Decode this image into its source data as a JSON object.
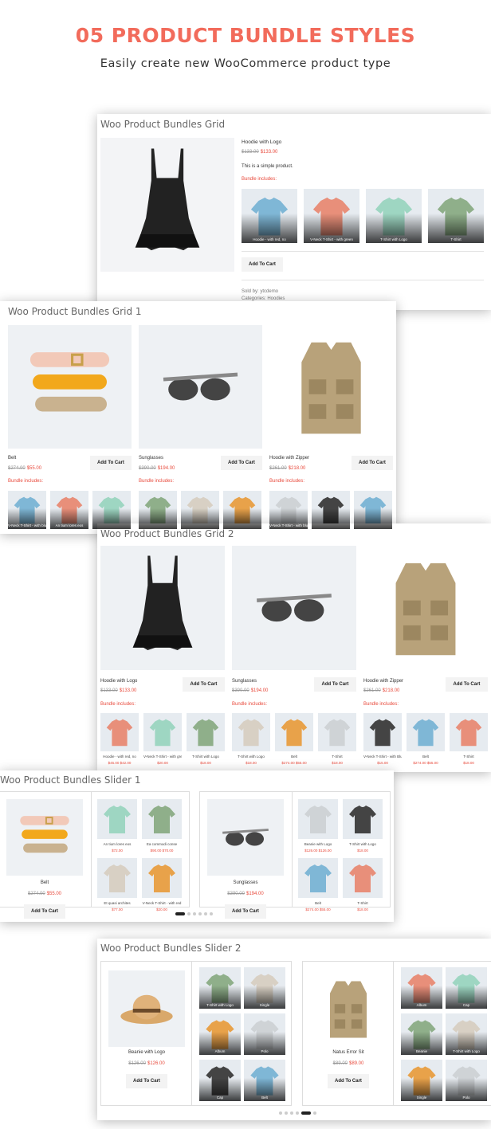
{
  "header": {
    "title": "05 PRODUCT BUNDLE STYLES",
    "subtitle": "Easily create new WooCommerce product type"
  },
  "grid": {
    "title": "Woo Product Bundles Grid",
    "product": "Hoodie with Logo",
    "old_price": "$133.00",
    "price": "$133.00",
    "desc": "This is a simple product.",
    "bundle_label": "Bundle includes:",
    "thumbs": [
      "Hoodie - with red, no",
      "V-Neck T-Shirt - with green",
      "T-Shirt with Logo",
      "T-Shirt"
    ],
    "add_to_cart": "Add To Cart",
    "sold_by": "Sold by: ytcdemo",
    "categories": "Categories: Hoodies"
  },
  "grid1": {
    "title": "Woo Product Bundles Grid 1",
    "bundle_label": "Bundle includes:",
    "add_to_cart": "Add To Cart",
    "products": [
      {
        "name": "Belt",
        "old": "$274.00",
        "price": "$55.00",
        "thumbs": [
          "V-Neck T-Shirt - with blue",
          "An tium lores eos",
          ""
        ]
      },
      {
        "name": "Sunglasses",
        "old": "$390.00",
        "price": "$194.00",
        "thumbs": [
          "",
          "",
          ""
        ]
      },
      {
        "name": "Hoodie with Zipper",
        "old": "$261.00",
        "price": "$218.00",
        "thumbs": [
          "V-Neck T-Shirt - with blue",
          "",
          ""
        ]
      }
    ]
  },
  "grid2": {
    "title": "Woo Product Bundles Grid 2",
    "bundle_label": "Bundle includes:",
    "add_to_cart": "Add To Cart",
    "products": [
      {
        "name": "Hoodie with Logo",
        "old": "$133.00",
        "price": "$133.00",
        "thumbs": [
          {
            "n": "Hoodie - with red, no",
            "p": "$45.00 $42.00"
          },
          {
            "n": "V-Neck T-Shirt - with green",
            "p": "$20.00"
          },
          {
            "n": "T-Shirt with Logo",
            "p": "$18.00"
          }
        ]
      },
      {
        "name": "Sunglasses",
        "old": "$390.00",
        "price": "$194.00",
        "thumbs": [
          {
            "n": "T-Shirt with Logo",
            "p": "$18.00"
          },
          {
            "n": "Belt",
            "p": "$274.00 $55.00"
          },
          {
            "n": "T-Shirt",
            "p": "$18.00"
          }
        ]
      },
      {
        "name": "Hoodie with Zipper",
        "old": "$261.00",
        "price": "$218.00",
        "thumbs": [
          {
            "n": "V-Neck T-Shirt - with Blue",
            "p": "$15.00"
          },
          {
            "n": "Belt",
            "p": "$274.00 $55.00"
          },
          {
            "n": "T-Shirt",
            "p": "$18.00"
          }
        ]
      }
    ]
  },
  "slider1": {
    "title": "Woo Product Bundles Slider 1",
    "add_to_cart": "Add To Cart",
    "cards": [
      {
        "name": "Belt",
        "old": "$274.00",
        "price": "$55.00",
        "items": [
          {
            "n": "An tium lores eos",
            "p": "$72.00"
          },
          {
            "n": "Ea commodi conse",
            "p": "$90.00 $70.00"
          },
          {
            "n": "Et quasi archites",
            "p": "$77.00"
          },
          {
            "n": "V-Neck T-Shirt - with red",
            "p": "$20.00"
          }
        ]
      },
      {
        "name": "Sunglasses",
        "old": "$390.00",
        "price": "$194.00",
        "items": [
          {
            "n": "Beanie with Logo",
            "p": "$126.00 $126.00"
          },
          {
            "n": "T-Shirt with Logo",
            "p": "$18.00"
          },
          {
            "n": "Belt",
            "p": "$274.00 $55.00"
          },
          {
            "n": "T-Shirt",
            "p": "$18.00"
          }
        ]
      }
    ]
  },
  "slider2": {
    "title": "Woo Product Bundles Slider 2",
    "add_to_cart": "Add To Cart",
    "cards": [
      {
        "name": "Beanie with Logo",
        "old": "$126.00",
        "price": "$126.00",
        "items": [
          "T-Shirt with Logo",
          "Single",
          "Album",
          "Polo",
          "Cap",
          "Belt"
        ]
      },
      {
        "name": "Natus Error Sit",
        "old": "$89.00",
        "price": "$89.00",
        "items": [
          "Album",
          "Cap",
          "Beanie",
          "T-Shirt with Logo",
          "Single",
          "Polo"
        ]
      }
    ]
  }
}
